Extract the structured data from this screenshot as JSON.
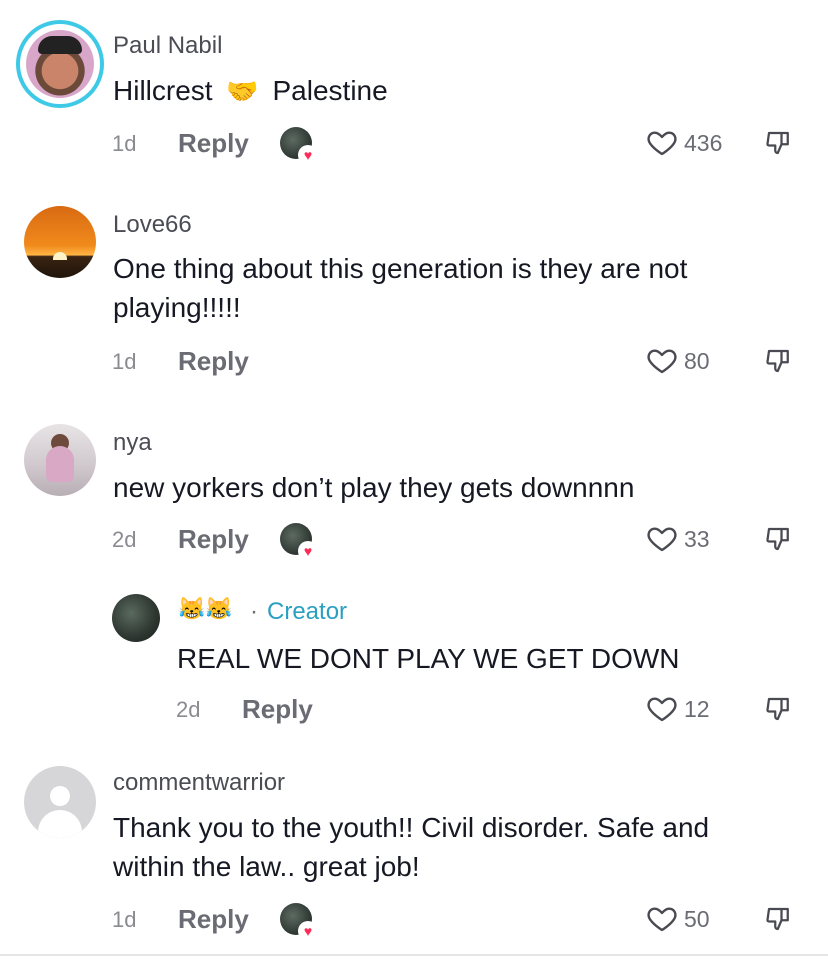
{
  "comments": [
    {
      "username": "Paul Nabil",
      "text_a": "Hillcrest",
      "emoji": "🤝",
      "text_b": "Palestine",
      "time": "1d",
      "reply_label": "Reply",
      "likes": "436"
    },
    {
      "username": "Love66",
      "text_line1": "One thing about this generation is they are not",
      "text_line2": "playing!!!!!",
      "time": "1d",
      "reply_label": "Reply",
      "likes": "80"
    },
    {
      "username": "nya",
      "text": "new yorkers don’t play they gets downnnn",
      "time": "2d",
      "reply_label": "Reply",
      "likes": "33"
    },
    {
      "username_emojis": "😹😹",
      "separator": "·",
      "creator_label": "Creator",
      "text": "REAL WE DONT PLAY WE GET DOWN",
      "time": "2d",
      "reply_label": "Reply",
      "likes": "12"
    },
    {
      "username": "commentwarrior",
      "text_line1": "Thank you to the youth!! Civil disorder. Safe and",
      "text_line2": "within the law.. great job!",
      "time": "1d",
      "reply_label": "Reply",
      "likes": "50"
    }
  ],
  "colors": {
    "creator_accent": "#2a9fc0",
    "like_heart": "#fe2c55",
    "avatar_ring": "#3ec9e6"
  }
}
